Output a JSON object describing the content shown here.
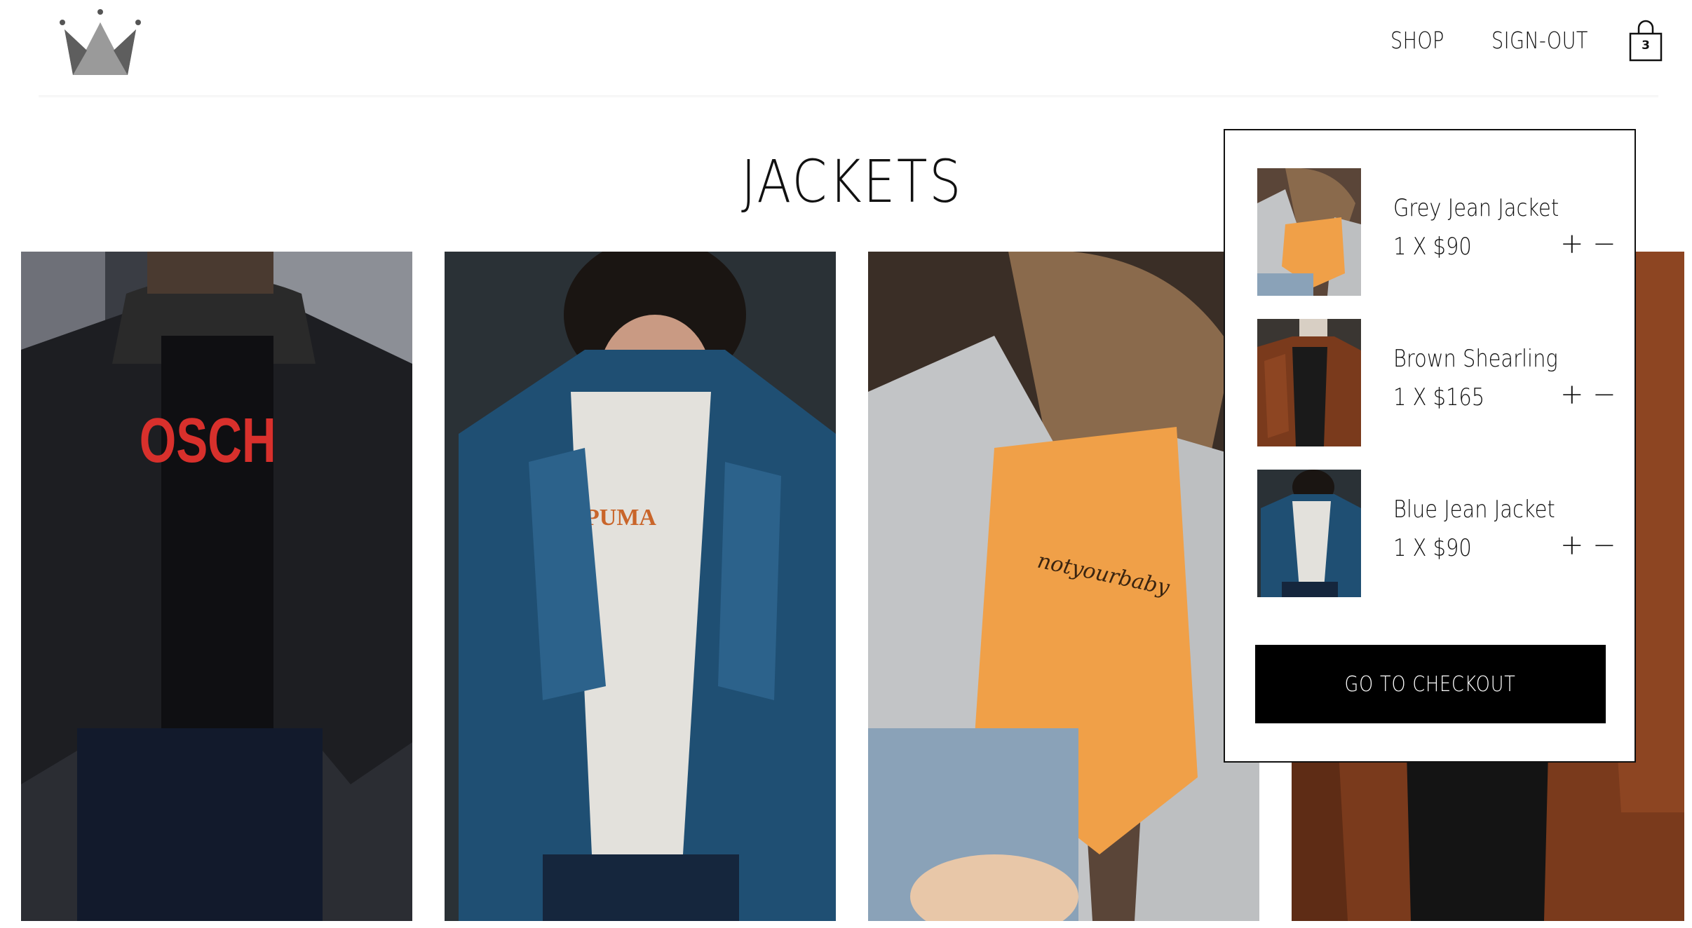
{
  "header": {
    "nav": {
      "shop": "SHOP",
      "signout": "SIGN-OUT"
    },
    "cart_count": "3",
    "logo_icon": "crown-icon",
    "cart_icon": "shopping-bag-icon"
  },
  "page": {
    "title": "JACKETS"
  },
  "products": [
    {
      "description": "man in black denim jacket",
      "image": "black-jacket-photo"
    },
    {
      "description": "man in blue denim jacket",
      "image": "blue-jacket-photo"
    },
    {
      "description": "woman in grey denim jacket",
      "image": "grey-jacket-photo"
    },
    {
      "description": "brown shearling jacket",
      "image": "brown-jacket-photo"
    }
  ],
  "cart": {
    "items": [
      {
        "name": "Grey Jean Jacket",
        "qty_price": "1 X $90",
        "plus": "+",
        "minus": "−"
      },
      {
        "name": "Brown Shearling",
        "qty_price": "1 X $165",
        "plus": "+",
        "minus": "−"
      },
      {
        "name": "Blue Jean Jacket",
        "qty_price": "1 X $90",
        "plus": "+",
        "minus": "−"
      }
    ],
    "checkout_label": "GO TO CHECKOUT"
  },
  "colors": {
    "accent": "#000000",
    "logo_grey": "#6b6b6b",
    "orange_shirt": "#f0a048",
    "denim_blue": "#1f4f73",
    "brown_leather": "#7a3a1c"
  }
}
